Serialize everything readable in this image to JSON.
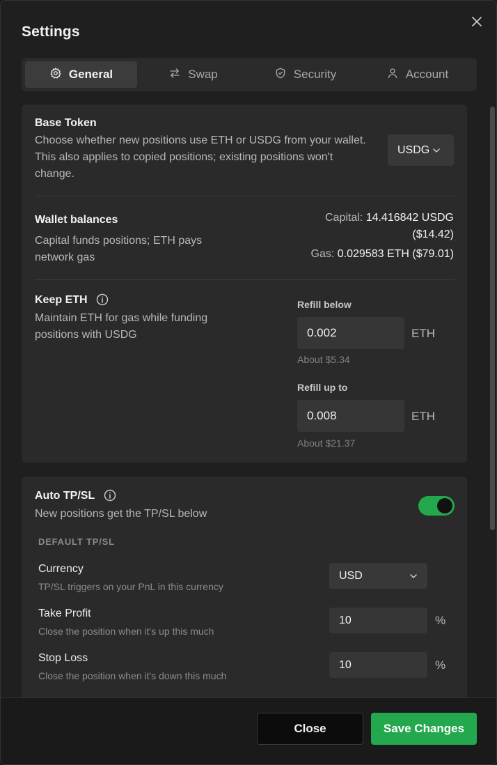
{
  "dialog": {
    "title": "Settings"
  },
  "tabs": [
    {
      "label": "General",
      "icon": "gear-icon",
      "active": true
    },
    {
      "label": "Swap",
      "icon": "swap-arrows-icon",
      "active": false
    },
    {
      "label": "Security",
      "icon": "shield-icon",
      "active": false
    },
    {
      "label": "Account",
      "icon": "user-icon",
      "active": false
    }
  ],
  "base_token": {
    "label": "Base Token",
    "description": "Choose whether new positions use ETH or USDG from your wallet. This also applies to copied positions; existing positions won't change.",
    "selected": "USDG"
  },
  "wallet_balances": {
    "label": "Wallet balances",
    "description": "Capital funds positions; ETH pays network gas",
    "capital_label": "Capital:",
    "capital_value": "14.416842 USDG",
    "capital_usd": "($14.42)",
    "gas_label": "Gas:",
    "gas_value": "0.029583 ETH ($79.01)"
  },
  "keep_eth": {
    "label": "Keep ETH",
    "description": "Maintain ETH for gas while funding positions with USDG",
    "refill_below_label": "Refill below",
    "refill_below_value": "0.002",
    "refill_below_unit": "ETH",
    "refill_below_hint": "About $5.34",
    "refill_up_label": "Refill up to",
    "refill_up_value": "0.008",
    "refill_up_unit": "ETH",
    "refill_up_hint": "About $21.37"
  },
  "auto_tpsl": {
    "label": "Auto TP/SL",
    "description": "New positions get the TP/SL below",
    "enabled": true,
    "section_heading": "DEFAULT TP/SL",
    "currency_label": "Currency",
    "currency_desc": "TP/SL triggers on your PnL in this currency",
    "currency_value": "USD",
    "tp_label": "Take Profit",
    "tp_desc": "Close the position when it's up this much",
    "tp_value": "10",
    "tp_unit": "%",
    "sl_label": "Stop Loss",
    "sl_desc": "Close the position when it's down this much",
    "sl_value": "10",
    "sl_unit": "%"
  },
  "footer": {
    "close_label": "Close",
    "save_label": "Save Changes"
  },
  "colors": {
    "accent": "#23a84d",
    "background": "#1f1f1f",
    "card": "#2a2a2a"
  }
}
